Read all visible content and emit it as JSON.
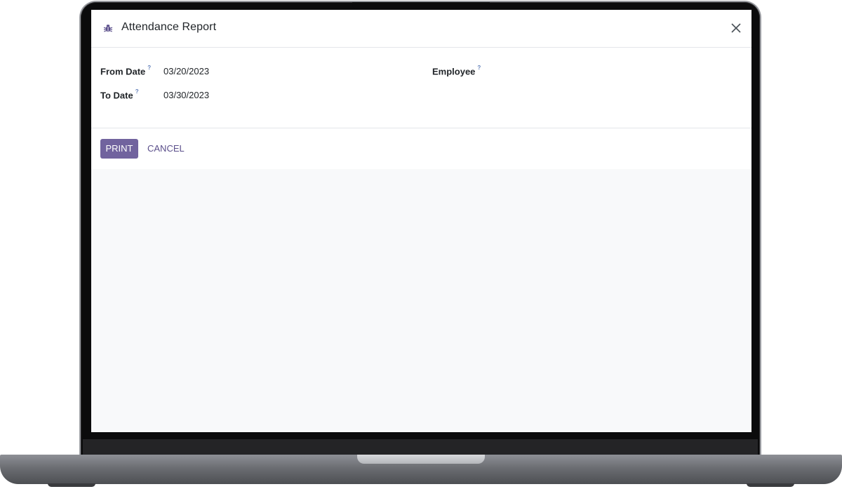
{
  "dialog": {
    "title": "Attendance Report",
    "title_icon": "bug-icon",
    "close_icon": "close-icon"
  },
  "form": {
    "from_date": {
      "label": "From Date",
      "help": "?",
      "value": "03/20/2023"
    },
    "to_date": {
      "label": "To Date",
      "help": "?",
      "value": "03/30/2023"
    },
    "employee": {
      "label": "Employee",
      "help": "?",
      "value": ""
    }
  },
  "footer": {
    "print_label": "PRINT",
    "cancel_label": "CANCEL"
  },
  "colors": {
    "primary": "#71639e",
    "link": "#5b4f8b",
    "help": "#5f7db8",
    "backdrop": "#f8f9fa"
  }
}
